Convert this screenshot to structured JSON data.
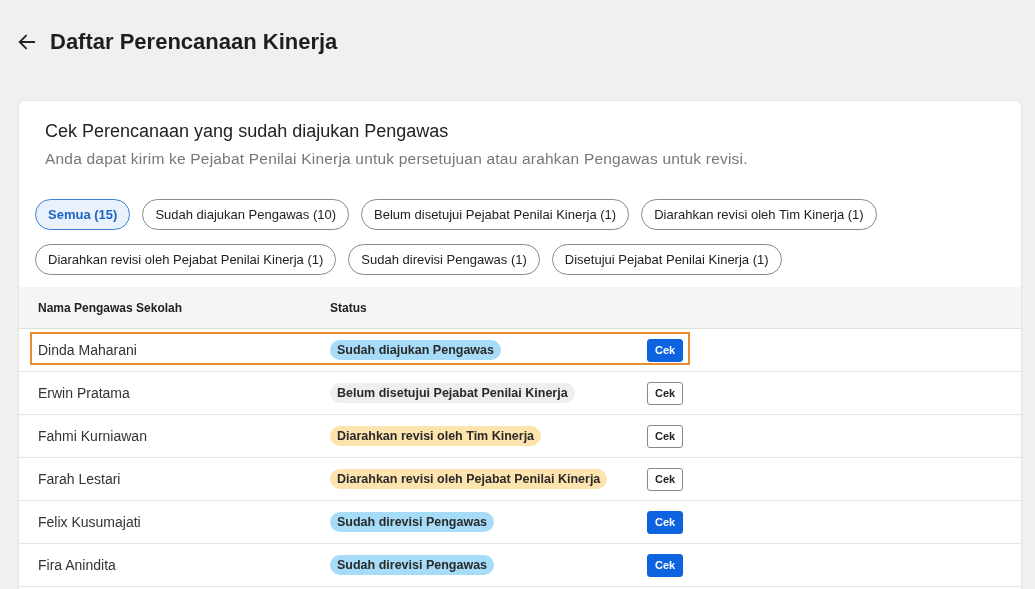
{
  "page": {
    "title": "Daftar Perencanaan Kinerja"
  },
  "card": {
    "title": "Cek Perencanaan yang sudah diajukan Pengawas",
    "subtitle": "Anda dapat kirim ke Pejabat Penilai Kinerja untuk persetujuan atau arahkan Pengawas untuk revisi."
  },
  "filters": [
    {
      "label": "Semua (15)",
      "selected": true
    },
    {
      "label": "Sudah diajukan Pengawas (10)",
      "selected": false
    },
    {
      "label": "Belum disetujui Pejabat Penilai Kinerja (1)",
      "selected": false
    },
    {
      "label": "Diarahkan revisi oleh Tim Kinerja (1)",
      "selected": false
    },
    {
      "label": "Diarahkan revisi oleh Pejabat Penilai Kinerja (1)",
      "selected": false
    },
    {
      "label": "Sudah direvisi Pengawas (1)",
      "selected": false
    },
    {
      "label": "Disetujui Pejabat Penilai Kinerja (1)",
      "selected": false
    }
  ],
  "table": {
    "columns": [
      "Nama Pengawas Sekolah",
      "Status"
    ],
    "rows": [
      {
        "name": "Dinda Maharani",
        "status": "Sudah diajukan Pengawas",
        "color": "#a6dcf7",
        "action": {
          "label": "Cek",
          "kind": "primary"
        },
        "selected": true
      },
      {
        "name": "Erwin Pratama",
        "status": "Belum disetujui Pejabat Penilai Kinerja",
        "color": "#eeeeee",
        "action": {
          "label": "Cek",
          "kind": "outline"
        },
        "selected": false
      },
      {
        "name": "Fahmi Kurniawan",
        "status": "Diarahkan revisi oleh Tim Kinerja",
        "color": "#fde4ae",
        "action": {
          "label": "Cek",
          "kind": "outline"
        },
        "selected": false
      },
      {
        "name": "Farah Lestari",
        "status": "Diarahkan revisi oleh Pejabat Penilai Kinerja",
        "color": "#fde4ae",
        "action": {
          "label": "Cek",
          "kind": "outline"
        },
        "selected": false
      },
      {
        "name": "Felix Kusumajati",
        "status": "Sudah direvisi Pengawas",
        "color": "#a6dcf7",
        "action": {
          "label": "Cek",
          "kind": "primary"
        },
        "selected": false
      },
      {
        "name": "Fira Anindita",
        "status": "Sudah direvisi Pengawas",
        "color": "#a6dcf7",
        "action": {
          "label": "Cek",
          "kind": "primary"
        },
        "selected": false
      }
    ]
  }
}
